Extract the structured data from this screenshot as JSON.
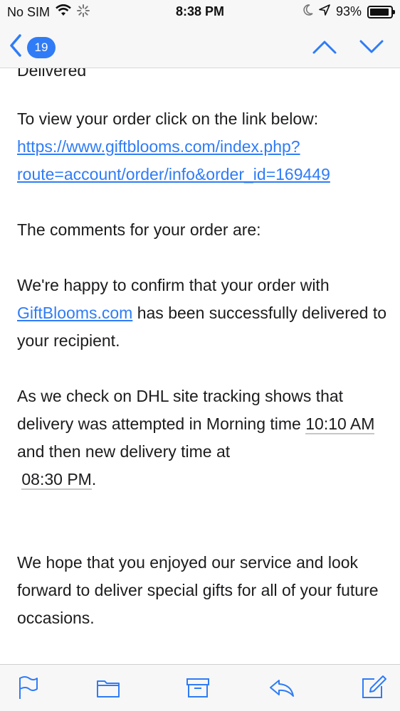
{
  "status_bar": {
    "carrier": "No SIM",
    "time": "8:38 PM",
    "battery_percent": "93%",
    "battery_level": 0.93,
    "icons": [
      "wifi-icon",
      "loading-spinner-icon",
      "moon-icon",
      "location-arrow-icon",
      "battery-icon"
    ]
  },
  "nav": {
    "back_count": "19",
    "icons": [
      "chevron-left-icon",
      "chevron-up-icon",
      "chevron-down-icon"
    ],
    "accent_color": "#2f7cf6"
  },
  "email": {
    "cut_off_text": "Delivered",
    "view_order_intro": "To view your order click on the link below:",
    "order_link_line1": "https://www.giftblooms.com/index.php?",
    "order_link_line2": "route=account/order/info&order_id=169449",
    "comments_heading": "The comments for your order are:",
    "confirm_part1": "We're happy to confirm that your order with",
    "confirm_link": "GiftBlooms.com",
    "confirm_part2": " has been successfully delivered to your recipient.",
    "dhl_part1": "As we check on DHL site tracking shows that delivery was attempted in Morning time ",
    "dhl_time1": "10:10 AM",
    "dhl_part2": " and then new delivery time at ",
    "dhl_time2": "08:30 PM",
    "dhl_part3": ".",
    "closing": "We hope that you enjoyed our service and look forward to deliver special gifts for all of your future occasions."
  },
  "toolbar": {
    "icons": [
      "flag-icon",
      "folder-icon",
      "archive-icon",
      "reply-icon",
      "compose-icon"
    ]
  }
}
